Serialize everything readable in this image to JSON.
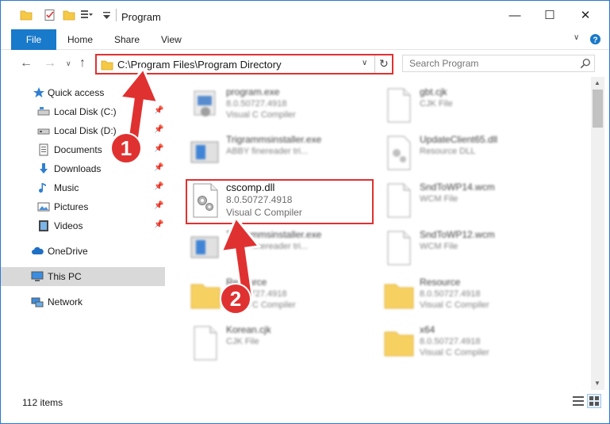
{
  "window": {
    "title": "Program",
    "controls": {
      "minimize": "—",
      "maximize": "☐",
      "close": "✕"
    }
  },
  "ribbon": {
    "tabs": [
      "File",
      "Home",
      "Share",
      "View"
    ]
  },
  "address": {
    "path": "C:\\Program Files\\Program Directory",
    "search_placeholder": "Search Program"
  },
  "nav": {
    "items": [
      {
        "label": "Quick access",
        "icon": "star-icon"
      },
      {
        "label": "Local Disk (C:)",
        "icon": "drive-icon",
        "pinned": true
      },
      {
        "label": "Local Disk (D:)",
        "icon": "drive-icon",
        "pinned": true
      },
      {
        "label": "Documents",
        "icon": "documents-icon",
        "pinned": true
      },
      {
        "label": "Downloads",
        "icon": "download-icon",
        "pinned": true
      },
      {
        "label": "Music",
        "icon": "music-icon",
        "pinned": true
      },
      {
        "label": "Pictures",
        "icon": "pictures-icon",
        "pinned": true
      },
      {
        "label": "Videos",
        "icon": "videos-icon",
        "pinned": true
      },
      {
        "label": "OneDrive",
        "icon": "cloud-icon"
      },
      {
        "label": "This PC",
        "icon": "computer-icon",
        "selected": true
      },
      {
        "label": "Network",
        "icon": "network-icon"
      }
    ]
  },
  "files": {
    "left": [
      {
        "name": "program.exe",
        "line1": "8.0.50727.4918",
        "line2": "Visual C Compiler",
        "icon": "exe-icon"
      },
      {
        "name": "Trigrammsinstaller.exe",
        "line1": "ABBY finereader tri...",
        "line2": "",
        "icon": "installer-icon"
      },
      {
        "name": "cscomp.dll",
        "line1": "8.0.50727.4918",
        "line2": "Visual C Compiler",
        "icon": "dll-gear-icon"
      },
      {
        "name": "Trigrammsinstaller.exe",
        "line1": "ABBY finereader tri...",
        "line2": "",
        "icon": "installer-icon"
      },
      {
        "name": "Resource",
        "line1": "8.0.50727.4918",
        "line2": "Visual C Compiler",
        "icon": "folder-icon"
      },
      {
        "name": "Korean.cjk",
        "line1": "CJK File",
        "line2": "",
        "icon": "file-icon"
      }
    ],
    "right": [
      {
        "name": "gbt.cjk",
        "line1": "CJK File",
        "line2": "",
        "icon": "file-icon"
      },
      {
        "name": "UpdateClient65.dll",
        "line1": "Resource DLL",
        "line2": "",
        "icon": "dll-gear-icon"
      },
      {
        "name": "SndToWP14.wcm",
        "line1": "WCM File",
        "line2": "",
        "icon": "file-icon"
      },
      {
        "name": "SndToWP12.wcm",
        "line1": "WCM File",
        "line2": "",
        "icon": "file-icon"
      },
      {
        "name": "Resource",
        "line1": "8.0.50727.4918",
        "line2": "Visual C Compiler",
        "icon": "folder-icon"
      },
      {
        "name": "x64",
        "line1": "8.0.50727.4918",
        "line2": "Visual C Compiler",
        "icon": "folder-icon"
      }
    ]
  },
  "status": {
    "item_count": "112 items"
  },
  "annotations": {
    "step1": "1",
    "step2": "2"
  },
  "colors": {
    "accent": "#1979ca",
    "annotation": "#e03131",
    "selected_nav": "#d9d9d9"
  }
}
